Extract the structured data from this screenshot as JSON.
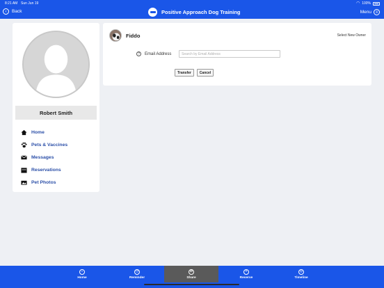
{
  "status_bar": {
    "time": "8:21 AM",
    "date": "Sun Jun 19",
    "battery": "100%"
  },
  "nav": {
    "back_label": "Back",
    "title": "Positive Approach Dog Training",
    "menu_label": "Menu"
  },
  "profile": {
    "name": "Robert Smith",
    "menu": [
      {
        "label": "Home",
        "icon": "house-icon"
      },
      {
        "label": "Pets & Vaccines",
        "icon": "paw-icon"
      },
      {
        "label": "Messages",
        "icon": "envelope-icon"
      },
      {
        "label": "Reservations",
        "icon": "calendar-icon"
      },
      {
        "label": "Pet Photos",
        "icon": "photo-icon"
      }
    ]
  },
  "transfer": {
    "pet_name": "Fiddo",
    "select_owner_label": "Select New Owner",
    "email_label": "Email Address",
    "email_placeholder": "Search by Email Address",
    "email_value": "",
    "transfer_label": "Transfer",
    "cancel_label": "Cancel"
  },
  "tabs": [
    {
      "label": "Home",
      "icon": "home-icon",
      "active": false
    },
    {
      "label": "Reminder",
      "icon": "clock-icon",
      "active": false
    },
    {
      "label": "Share",
      "icon": "share-icon",
      "active": true
    },
    {
      "label": "Reserve",
      "icon": "plus-icon",
      "active": false
    },
    {
      "label": "Timeline",
      "icon": "timeline-icon",
      "active": false
    }
  ],
  "colors": {
    "brand": "#1a56e8",
    "link": "#2b4fa8",
    "active_tab": "#5a5a5a"
  }
}
